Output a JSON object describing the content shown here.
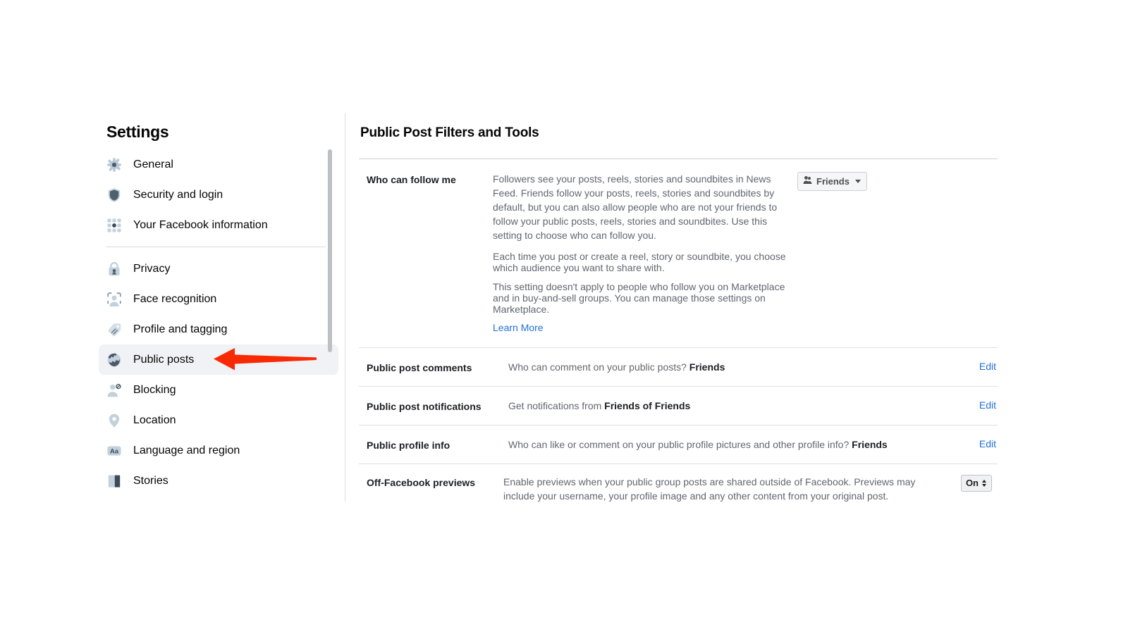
{
  "sidebar": {
    "title": "Settings",
    "groups": [
      {
        "items": [
          {
            "label": "General",
            "icon": "gear-icon",
            "selected": false
          },
          {
            "label": "Security and login",
            "icon": "shield-icon",
            "selected": false
          },
          {
            "label": "Your Facebook information",
            "icon": "grid-dots-icon",
            "selected": false
          }
        ]
      },
      {
        "items": [
          {
            "label": "Privacy",
            "icon": "lock-icon",
            "selected": false
          },
          {
            "label": "Face recognition",
            "icon": "face-scan-icon",
            "selected": false
          },
          {
            "label": "Profile and tagging",
            "icon": "tag-icon",
            "selected": false
          },
          {
            "label": "Public posts",
            "icon": "globe-icon",
            "selected": true
          },
          {
            "label": "Blocking",
            "icon": "person-block-icon",
            "selected": false
          },
          {
            "label": "Location",
            "icon": "location-pin-icon",
            "selected": false
          },
          {
            "label": "Language and region",
            "icon": "language-aa-icon",
            "selected": false
          },
          {
            "label": "Stories",
            "icon": "book-icon",
            "selected": false
          }
        ]
      }
    ]
  },
  "annotation": {
    "arrow_color": "#f82a04",
    "arrow_points_to": "Public posts"
  },
  "main": {
    "heading": "Public Post Filters and Tools",
    "rows": {
      "follow": {
        "label": "Who can follow me",
        "desc1": "Followers see your posts, reels, stories and soundbites in News Feed. Friends follow your posts, reels, stories and soundbites by default, but you can also allow people who are not your friends to follow your public posts, reels, stories and soundbites. Use this setting to choose who can follow you.",
        "desc2": "Each time you post or create a reel, story or soundbite, you choose which audience you want to share with.",
        "desc3": "This setting doesn't apply to people who follow you on Marketplace and in buy-and-sell groups. You can manage those settings on Marketplace.",
        "learn_more": "Learn More",
        "audience_value": "Friends"
      },
      "comments": {
        "label": "Public post comments",
        "desc_prefix": "Who can comment on your public posts? ",
        "desc_value": "Friends",
        "action": "Edit"
      },
      "notifications": {
        "label": "Public post notifications",
        "desc_prefix": "Get notifications from ",
        "desc_value": "Friends of Friends",
        "action": "Edit"
      },
      "profile_info": {
        "label": "Public profile info",
        "desc_prefix": "Who can like or comment on your public profile pictures and other profile info? ",
        "desc_value": "Friends",
        "action": "Edit"
      },
      "off_facebook": {
        "label": "Off-Facebook previews",
        "desc": "Enable previews when your public group posts are shared outside of Facebook. Previews may include your username, your profile image and any other content from your original post.",
        "toggle_value": "On"
      }
    }
  },
  "colors": {
    "link": "#216fdb",
    "selected_row_bg": "#f0f2f5",
    "text_primary": "#1c1e21",
    "text_secondary": "#606770"
  }
}
